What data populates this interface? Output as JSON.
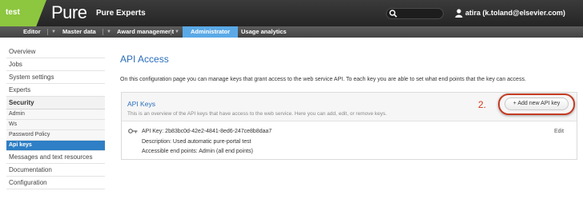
{
  "topbar": {
    "env_label": "test",
    "logo": "Pure",
    "tagline": "Pure Experts",
    "search_value": "",
    "user": "atira (k.toland@elsevier.com)"
  },
  "tabs": [
    {
      "label": "Editor",
      "dropdown": true
    },
    {
      "label": "Master data",
      "dropdown": true
    },
    {
      "label": "Award management",
      "dropdown": true
    },
    {
      "label": "Administrator",
      "dropdown": false,
      "active": true
    },
    {
      "label": "Usage analytics",
      "dropdown": false
    }
  ],
  "sidebar": {
    "items": [
      {
        "label": "Overview"
      },
      {
        "label": "Jobs"
      },
      {
        "label": "System settings"
      },
      {
        "label": "Experts"
      },
      {
        "label": "Security"
      },
      {
        "label": "Admin"
      },
      {
        "label": "Ws"
      },
      {
        "label": "Password Policy"
      },
      {
        "label": "Api keys"
      },
      {
        "label": "Messages and text resources"
      },
      {
        "label": "Documentation"
      },
      {
        "label": "Configuration"
      }
    ]
  },
  "main": {
    "title": "API Access",
    "intro": "On this configuration page you can manage keys that grant access to the web service API. To each key you are able to set what end points that the key can access.",
    "card": {
      "title": "API Keys",
      "description": "This is an overview of the API keys that have access to the web service. Here you can add, edit, or remove keys.",
      "step_label": "2.",
      "add_button": "+ Add new API key",
      "key": {
        "key_line": "API Key: 2b83bc0d-42e2-4841-8ed6-247ce8b8daa7",
        "description_line": "Description: Used automatic pure-portal test",
        "endpoints_line": "Accessible end points: Admin (all end points)",
        "edit_label": "Edit"
      }
    }
  },
  "colors": {
    "brand_green": "#8dc63f",
    "active_tab": "#5aa9e6",
    "link_blue": "#2a6ebb",
    "sidebar_active": "#2e7fc5",
    "annotation_red": "#c43c24"
  }
}
